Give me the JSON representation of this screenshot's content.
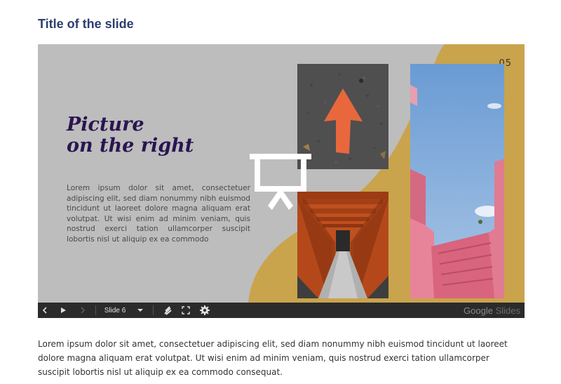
{
  "page": {
    "title": "Title of the slide",
    "description": "Lorem ipsum dolor sit amet, consectetuer adipiscing elit, sed diam nonummy nibh euismod tincidunt ut laoreet dolore magna aliquam erat volutpat. Ut wisi enim ad minim veniam, quis nostrud exerci tation ullamcorper suscipit lobortis nisl ut aliquip ex ea commodo consequat."
  },
  "slide": {
    "number": "05",
    "heading_line1": "Picture",
    "heading_line2": "on the right",
    "body": "Lorem ipsum dolor sit amet, consectetuer adipiscing elit, sed diam nonummy nibh euismod tincidunt ut laoreet dolore magna aliquam erat volutpat. Ut wisi enim ad minim veniam, quis nostrud exerci tation ullamcorper suscipit lobortis nisl ut aliquip ex ea commodo",
    "colors": {
      "background": "#bdbdbd",
      "accent_shape": "#c9a44c",
      "heading": "#2a1550"
    },
    "images": [
      "arrow-on-asphalt-photo",
      "torii-gate-tunnel-photo",
      "pink-building-photo"
    ],
    "overlay_icon": "presentation-icon"
  },
  "controls": {
    "prev_icon": "chevron-left-icon",
    "play_icon": "play-icon",
    "next_icon": "chevron-right-icon",
    "slide_selector": "Slide 6",
    "dropdown_icon": "caret-down-icon",
    "pointer_icon": "laser-pointer-icon",
    "fullscreen_icon": "fullscreen-icon",
    "settings_icon": "gear-icon",
    "brand_word1": "Google",
    "brand_word2": "Slides"
  }
}
